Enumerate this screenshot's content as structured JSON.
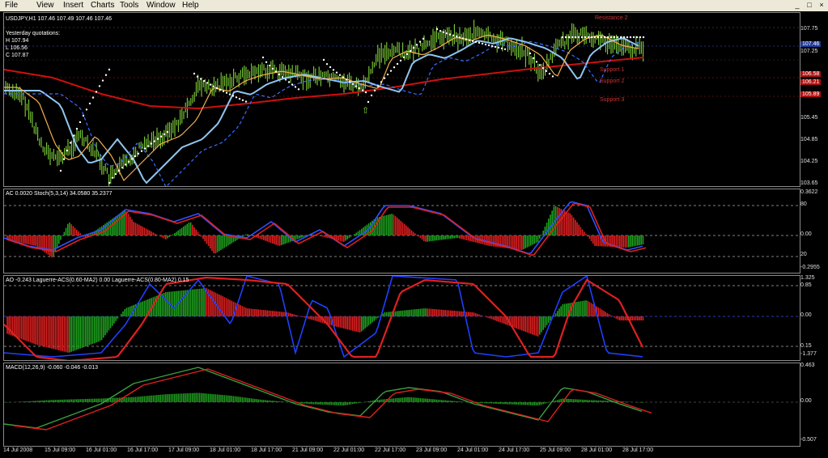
{
  "menu": [
    "File",
    "View",
    "Insert",
    "Charts",
    "Tools",
    "Window",
    "Help"
  ],
  "window_controls": [
    "_",
    "□",
    "×"
  ],
  "main_chart": {
    "symbol_line": "USDJPY,H1  107.46 107.49 107.46 107.46",
    "yesterday_title": "Yesterday quotations:",
    "yesterday_high": "H 107.94",
    "yesterday_low": "L 106.56",
    "yesterday_close": "C 107.87",
    "levels": [
      "Resistance 2",
      "Support 1",
      "Support 2",
      "Support 3"
    ],
    "price_scale": [
      "107.75",
      "107.25",
      "105.45",
      "104.85",
      "104.25",
      "103.65"
    ],
    "price_tags": [
      "107.46",
      "106.58",
      "106.21",
      "105.89"
    ],
    "colors": {
      "candles": "#7fd03a",
      "ma_fast": "#f4b14a",
      "ma_slow": "#cc1010",
      "ma_blue": "#8fc6f0",
      "ma_blue_dash": "#3a6fff",
      "psar": "#ffffff"
    }
  },
  "ac_panel": {
    "label": "AC 0.0020  Stoch(5,3,14) 34.0580 35.2377",
    "scale": [
      "0.3622",
      "80",
      "0.00",
      "20",
      "-0.2955"
    ]
  },
  "ao_panel": {
    "label": "AO -0.243  Laguerre-ACS(0.60-MA2) 0.00  Laguerre-ACS(0.80-MA2) 0.15",
    "scale": [
      "1.325",
      "0.85",
      "0.00",
      "0.15",
      "-1.377"
    ]
  },
  "macd_panel": {
    "label": "MACD(12,26,9) -0.060 -0.046 -0.013",
    "scale": [
      "0.463",
      "0.00",
      "-0.507"
    ]
  },
  "time_axis": [
    "14 Jul 2008",
    "15 Jul 09:00",
    "16 Jul 01:00",
    "16 Jul 17:00",
    "17 Jul 09:00",
    "18 Jul 01:00",
    "18 Jul 17:00",
    "21 Jul 09:00",
    "22 Jul 01:00",
    "22 Jul 17:00",
    "23 Jul 09:00",
    "24 Jul 01:00",
    "24 Jul 17:00",
    "25 Jul 09:00",
    "28 Jul 01:00",
    "28 Jul 17:00"
  ]
}
